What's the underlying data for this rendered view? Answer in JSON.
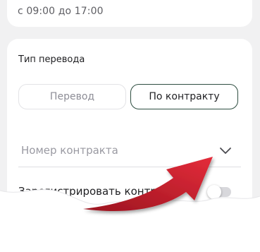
{
  "top_card": {
    "hours_text": "с 09:00 до 17:00"
  },
  "transfer_type": {
    "label": "Тип перевода",
    "options": [
      "Перевод",
      "По контракту"
    ],
    "selected": "По контракту"
  },
  "contract_field": {
    "placeholder": "Номер контракта",
    "icon": "chevron-down-icon"
  },
  "register_contract": {
    "label": "Зарегистрировать контракт",
    "enabled": false
  },
  "annotation": {
    "arrow_color": "#d8232f"
  },
  "colors": {
    "background": "#f1f1f2",
    "card": "#ffffff",
    "selected_border": "#2f4e41",
    "muted_text": "#8d8d96"
  }
}
